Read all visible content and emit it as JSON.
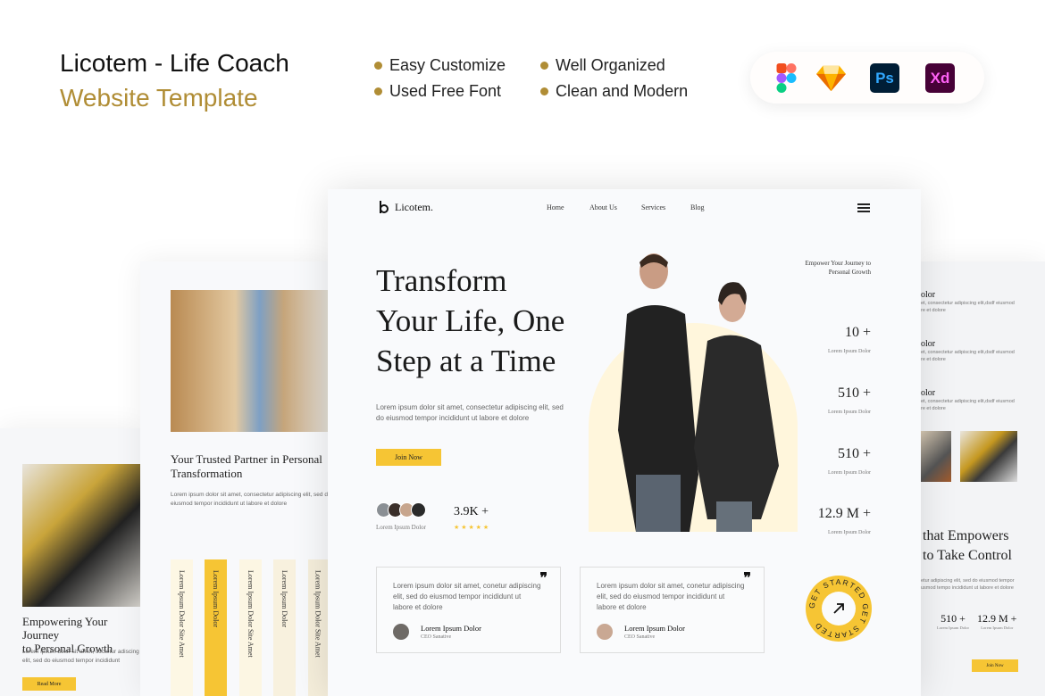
{
  "header": {
    "title": "Licotem - Life Coach",
    "subtitle": "Website Template",
    "features": [
      "Easy Customize",
      "Well Organized",
      "Used Free Font",
      "Clean and Modern"
    ],
    "tools": [
      {
        "icon": "figma-icon"
      },
      {
        "icon": "sketch-icon"
      },
      {
        "icon": "photoshop-icon",
        "label": "Ps"
      },
      {
        "icon": "xd-icon",
        "label": "Xd"
      }
    ]
  },
  "colors": {
    "accent": "#f6c534",
    "gold": "#b08d35"
  },
  "main": {
    "logo": "Licotem.",
    "nav": [
      "Home",
      "About Us",
      "Services",
      "Blog"
    ],
    "hero": [
      "Transform",
      "Your Life, One",
      "Step at a Time"
    ],
    "hero_text": [
      "Lorem ipsum dolor sit amet, consectetur adipiscing elit, sed",
      "do eiusmod tempor incididunt ut labore et dolore"
    ],
    "join": "Join Now",
    "tagline": [
      "Empower Your Journey to",
      "Personal Growth"
    ],
    "stats": [
      {
        "value": "10 +",
        "label": "Lorem Ipsum Dolor"
      },
      {
        "value": "510 +",
        "label": "Lorem Ipsum Dolor"
      },
      {
        "value": "510 +",
        "label": "Lorem Ipsum Dolor"
      },
      {
        "value": "12.9 M +",
        "label": "Lorem Ipsum Dolor"
      }
    ],
    "community": {
      "count": "3.9K +",
      "label": "Lorem Ipsum Dolor",
      "stars": "★ ★ ★ ★ ★",
      "rating": 5
    },
    "testimonials": [
      {
        "text": [
          "Lorem ipsum dolor sit amet, conetur adipiscing",
          "elit, sed do eiusmod tempor incididunt ut",
          "labore et dolore"
        ],
        "name": "Lorem Ipsum Dolor",
        "role": "CEO Sanative"
      },
      {
        "text": [
          "Lorem ipsum dolor sit amet, conetur adipiscing",
          "elit, sed do eiusmod tempor incididunt ut",
          "labore et dolore"
        ],
        "name": "Lorem Ipsum Dolor",
        "role": "CEO Sanative"
      }
    ],
    "badge": "GET STARTED GET STARTED"
  },
  "left": {
    "heading": [
      "Your Trusted Partner in Personal",
      "Transformation"
    ],
    "text": [
      "Lorem ipsum dolor sit amet, consectetur adipiscing elit, sed do",
      "eiusmod tempor incididunt ut labore et dolore"
    ],
    "columns": [
      "Lorem Ipsum Dolor Site Amet",
      "Lorem Ipsum Dolor",
      "Lorem Ipsum Dolor Site Amet",
      "Lorem Ipsum Dolor",
      "Lorem Ipsum Dolor Site Amet"
    ]
  },
  "far_left": {
    "heading": [
      "Empowering Your Journey",
      "to Personal Growth"
    ],
    "text": [
      "Lorem ipsum dolor sit amet, coctetur adiscing",
      "elit, sed do eiusmod tempor incididunt"
    ],
    "button": "Read More"
  },
  "right": {
    "items": [
      {
        "title": "olor",
        "text": [
          "et, consectetur adipiscing elit,dsdf eiusmod",
          "re et dolore"
        ]
      },
      {
        "title": "olor",
        "text": [
          "et, consectetur adipiscing elit,dsdf eiusmod",
          "re et dolore"
        ]
      },
      {
        "title": "olor",
        "text": [
          "et, consectetur adipiscing elit,dsdf eiusmod",
          "re et dolore"
        ]
      }
    ],
    "heading": [
      "that Empowers",
      "to Take Control"
    ],
    "text": [
      "etur adipiscing elit, sed do eiusmod tempor",
      "usmod tempo incididunt ut labore et dolore"
    ],
    "stats": [
      {
        "value": "510 +",
        "label": "Lorem Ipsum Dolor"
      },
      {
        "value": "12.9 M +",
        "label": "Lorem Ipsum Dolor"
      }
    ],
    "button": "Join Now"
  }
}
